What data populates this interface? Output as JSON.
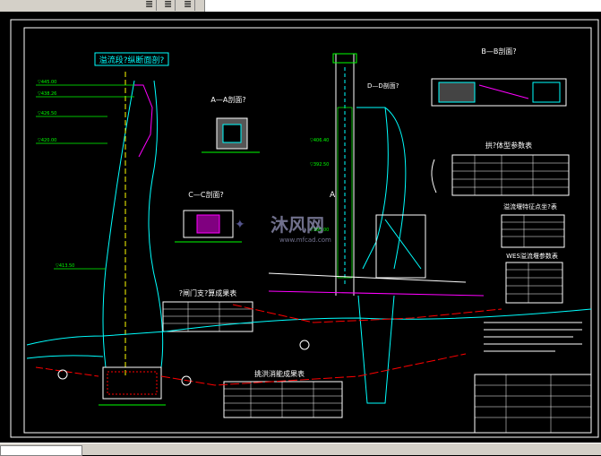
{
  "toolbar": {
    "icons": [
      "align-left-icon",
      "align-center-icon",
      "align-right-icon"
    ]
  },
  "drawing": {
    "title_main": "溢流段?纵断面剖?",
    "section_aa": "A—A剖面?",
    "section_bb": "B—B剖面?",
    "section_cc": "C—C剖面?",
    "section_dd": "D—D剖面?",
    "table_arch": "拱?体型参数表",
    "table_crest": "溢流堰特征点坐?表",
    "table_wes": "WES溢流堰参数表",
    "table_stress": "?闸门支?算成果表",
    "table_energy": "挑洪消能成果表",
    "label_a": "A",
    "label_c1": "C",
    "label_c2": "C",
    "watermark_text": "沐风网",
    "watermark_url": "www.mfcad.com",
    "elev": [
      "▽445.00",
      "▽438.26",
      "▽426.50",
      "▽420.00",
      "▽413.50",
      "▽406.40",
      "▽392.50",
      "▽380.00"
    ]
  },
  "colors": {
    "background": "#000000",
    "frame": "#ffffff",
    "cyan": "#00ffff",
    "yellow": "#ffff00",
    "green": "#00ff00",
    "red": "#ff0000",
    "magenta": "#ff00ff",
    "blue": "#3355ff"
  }
}
